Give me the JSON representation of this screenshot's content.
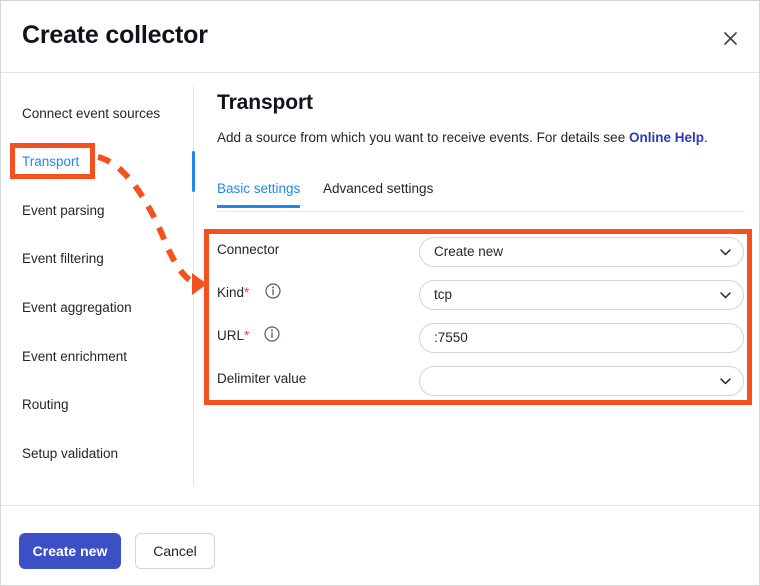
{
  "window": {
    "title": "Create collector",
    "close_icon": "close-icon"
  },
  "sidebar": {
    "items": [
      {
        "label": "Connect event sources",
        "active": false
      },
      {
        "label": "Transport",
        "active": true
      },
      {
        "label": "Event parsing",
        "active": false
      },
      {
        "label": "Event filtering",
        "active": false
      },
      {
        "label": "Event aggregation",
        "active": false
      },
      {
        "label": "Event enrichment",
        "active": false
      },
      {
        "label": "Routing",
        "active": false
      },
      {
        "label": "Setup validation",
        "active": false
      }
    ]
  },
  "main": {
    "title": "Transport",
    "description_prefix": "Add a source from which you want to receive events. For details see ",
    "description_link": "Online Help",
    "description_suffix": ".",
    "tabs": [
      {
        "label": "Basic settings",
        "active": true
      },
      {
        "label": "Advanced settings",
        "active": false
      }
    ],
    "fields": [
      {
        "label": "Connector",
        "required": false,
        "has_info": false,
        "type": "select",
        "value": "Create new",
        "placeholder": ""
      },
      {
        "label": "Kind",
        "required": true,
        "has_info": true,
        "type": "select",
        "value": "tcp",
        "placeholder": ""
      },
      {
        "label": "URL",
        "required": true,
        "has_info": true,
        "type": "text",
        "value": ":7550",
        "placeholder": ""
      },
      {
        "label": "Delimiter value",
        "required": false,
        "has_info": false,
        "type": "select",
        "value": "",
        "placeholder": ""
      }
    ]
  },
  "footer": {
    "primary_label": "Create new",
    "secondary_label": "Cancel"
  },
  "annotations": {
    "highlight_color": "#f4511e",
    "boxes": [
      "transport-nav-item",
      "transport-basic-settings-form"
    ],
    "arrow": "dashed-curved-arrow"
  },
  "colors": {
    "accent_blue": "#1f87f0",
    "link_indigo": "#2b3bb5",
    "primary_button": "#3d4fc4",
    "required_red": "#e0485a",
    "annotation_orange": "#f4511e"
  }
}
